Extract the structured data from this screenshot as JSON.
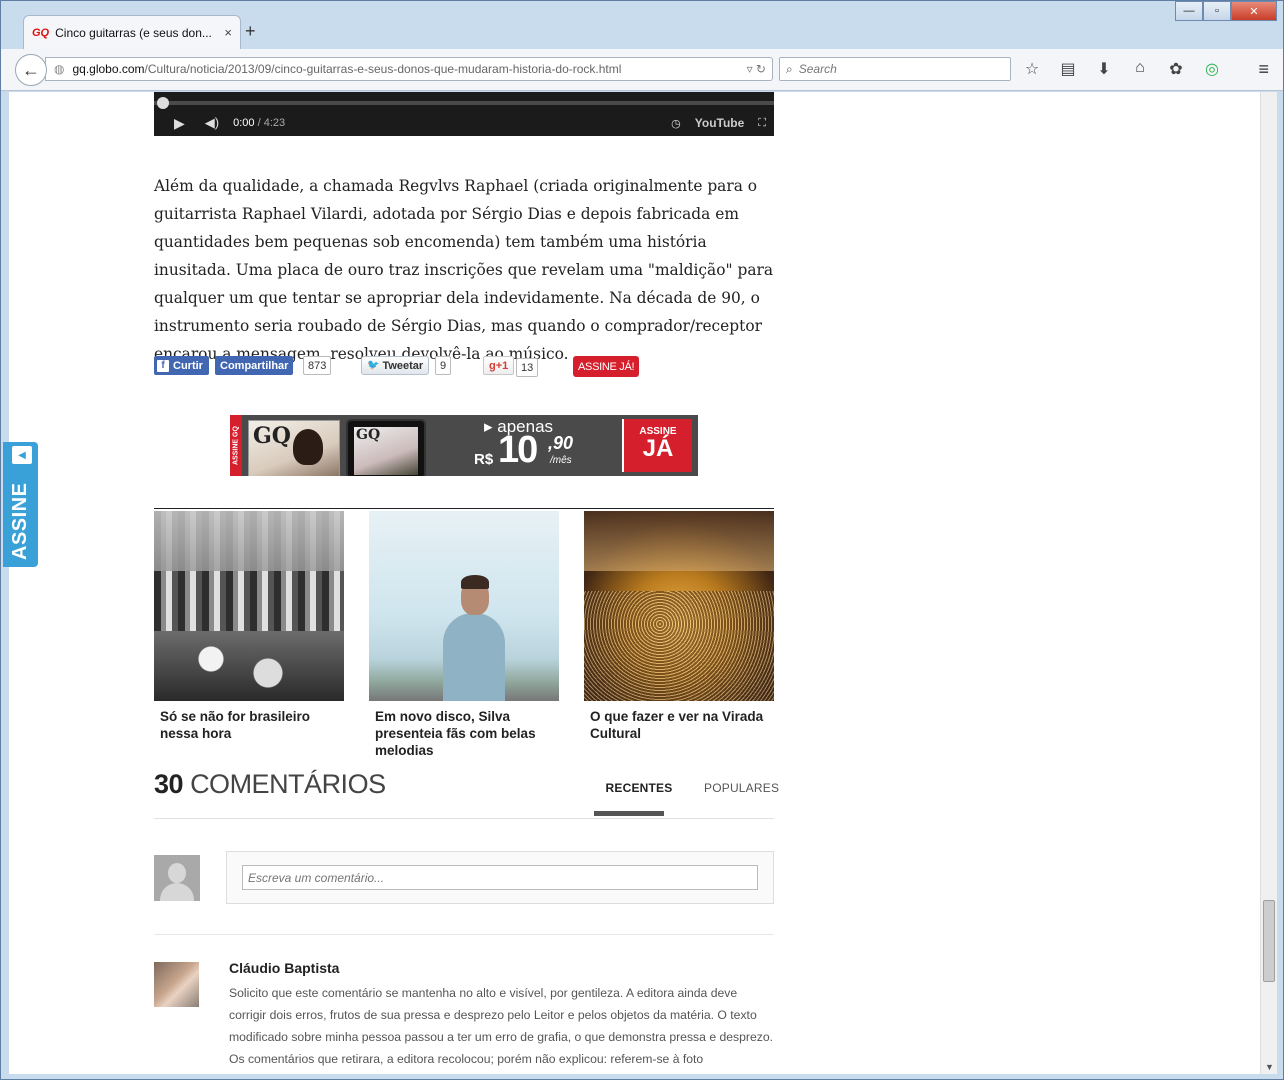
{
  "browser": {
    "tab_title": "Cinco guitarras (e seus don...",
    "tab_favicon": "GQ",
    "tab_close": "×",
    "new_tab": "+",
    "url_host": "gq.globo.com",
    "url_path": "/Cultura/noticia/2013/09/cinco-guitarras-e-seus-donos-que-mudaram-historia-do-rock.html",
    "search_placeholder": "Search",
    "win_min": "—",
    "win_max": "▫",
    "win_close": "✕"
  },
  "video": {
    "current_time": "0:00",
    "duration": "/ 4:23",
    "youtube_label": "YouTube"
  },
  "article": {
    "paragraph": "Além da qualidade, a chamada Regvlvs Raphael (criada originalmente para o guitarrista Raphael Vilardi, adotada por Sérgio Dias e depois fabricada em quantidades bem pequenas sob encomenda) tem também uma história inusitada. Uma placa de ouro traz inscrições que revelam uma \"maldição\" para qualquer um que tentar se apropriar dela indevidamente. Na década de 90, o instrumento seria roubado de Sérgio Dias, mas quando o comprador/receptor encarou a mensagem, resolveu devolvê-la ao músico."
  },
  "share": {
    "fb_like": "Curtir",
    "fb_share": "Compartilhar",
    "fb_count": "873",
    "tweet": "Tweetar",
    "tweet_count": "9",
    "gplus": "+1",
    "gplus_count": "13",
    "subscribe": "ASSINE JÁ!"
  },
  "banner": {
    "strip": "ASSINE GQ",
    "mag_logo": "GQ",
    "apenas": "apenas",
    "currency": "R$",
    "price_int": "10",
    "price_cents": ",90",
    "per_month": "/mês",
    "cta_top": "ASSINE",
    "cta_bottom": "JÁ"
  },
  "related": [
    {
      "title": "Só se não for brasileiro nessa hora"
    },
    {
      "title": "Em novo disco, Silva presenteia fãs com belas melodias"
    },
    {
      "title": "O que fazer e ver na Virada Cultural"
    }
  ],
  "comments": {
    "count": "30",
    "label": "COMENTÁRIOS",
    "tab_recent": "RECENTES",
    "tab_popular": "POPULARES",
    "input_placeholder": "Escreva um comentário...",
    "first": {
      "author": "Cláudio Baptista",
      "text": "Solicito que este comentário se mantenha no alto e visível, por gentileza. A editora ainda deve corrigir dois erros, frutos de sua pressa e desprezo pelo Leitor e pelos objetos da matéria. O texto modificado sobre minha pessoa passou a ter um erro de grafia, o que demonstra pressa e desprezo. Os comentários que retirara, a editora recolocou; porém não explicou: referem-se à foto"
    }
  },
  "side_tab": {
    "label": "ASSINE"
  }
}
